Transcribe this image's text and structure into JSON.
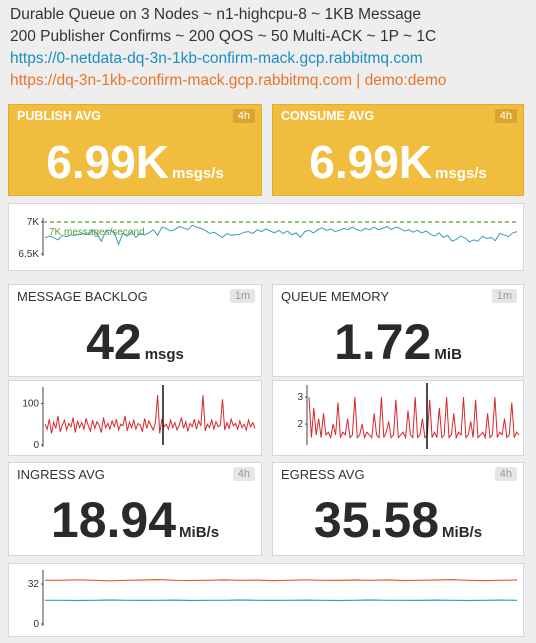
{
  "header": {
    "line1": "Durable Queue on 3 Nodes ~ n1-highcpu-8 ~ 1KB Message",
    "line2": "200 Publisher Confirms ~ 200 QOS ~ 50 Multi-ACK ~ 1P ~ 1C",
    "link_netdata": "https://0-netdata-dq-3n-1kb-confirm-mack.gcp.rabbitmq.com",
    "link_management": "https://dq-3n-1kb-confirm-mack.gcp.rabbitmq.com | demo:demo"
  },
  "panels": {
    "publish": {
      "title": "PUBLISH AVG",
      "range": "4h",
      "value": "6.99K",
      "unit": "msgs/s"
    },
    "consume": {
      "title": "CONSUME AVG",
      "range": "4h",
      "value": "6.99K",
      "unit": "msgs/s"
    },
    "backlog": {
      "title": "MESSAGE BACKLOG",
      "range": "1m",
      "value": "42",
      "unit": "msgs"
    },
    "memory": {
      "title": "QUEUE MEMORY",
      "range": "1m",
      "value": "1.72",
      "unit": "MiB"
    },
    "ingress": {
      "title": "INGRESS AVG",
      "range": "4h",
      "value": "18.94",
      "unit": "MiB/s"
    },
    "egress": {
      "title": "EGRESS AVG",
      "range": "4h",
      "value": "35.58",
      "unit": "MiB/s"
    }
  },
  "colors": {
    "gold": "#f1bd3e",
    "throughput_line": "#3a9dbb",
    "threshold_line": "#5aa02c",
    "red_line": "#d9262b",
    "ingress_line": "#e0632e",
    "egress_line": "#2c9ed6"
  },
  "chart_data": [
    {
      "type": "line",
      "id": "throughput",
      "yticks": [
        "7K",
        "6.5K"
      ],
      "annotation": "7K messages/second",
      "threshold": 7000,
      "ylim": [
        6500,
        7000
      ],
      "series": [
        {
          "values": [
            6750,
            6780,
            6760,
            6720,
            6790,
            6770,
            6800,
            6790,
            6810,
            6820,
            6800,
            6880,
            6820,
            6700,
            6850,
            6870,
            6830,
            6650,
            6820,
            6780,
            6850,
            6760,
            6820,
            6800,
            6830,
            6880,
            6790,
            6920,
            6900,
            6860,
            6880,
            6930,
            6910,
            6880,
            6950,
            6920,
            6900,
            6870,
            6820,
            6840,
            6800,
            6760,
            6820,
            6790,
            6800,
            6810,
            6840,
            6850,
            6820,
            6880,
            6850,
            6890,
            6860,
            6830,
            6870,
            6820,
            6860,
            6800,
            6830,
            6760,
            6850,
            6870,
            6830,
            6880,
            6910,
            6870,
            6890,
            6850,
            6870,
            6900,
            6880,
            6920,
            6880,
            6860,
            6900,
            6880,
            6920,
            6880,
            6900,
            6930,
            6880,
            6920,
            6900,
            6860,
            6880,
            6840,
            6870,
            6830,
            6860,
            6810,
            6780,
            6830,
            6760,
            6790,
            6700,
            6730,
            6780,
            6750,
            6690,
            6720,
            6700,
            6780,
            6740,
            6760,
            6710,
            6820,
            6800,
            6770,
            6830,
            6850
          ]
        }
      ]
    },
    {
      "type": "line",
      "id": "backlog",
      "yticks": [
        "100",
        "0"
      ],
      "ylim": [
        0,
        130
      ],
      "series": [
        {
          "values": [
            50,
            38,
            62,
            28,
            55,
            40,
            70,
            32,
            48,
            60,
            36,
            52,
            44,
            66,
            30,
            58,
            42,
            54,
            38,
            64,
            46,
            34,
            60,
            40,
            56,
            48,
            30,
            66,
            42,
            52,
            38,
            58,
            44,
            62,
            36,
            50,
            46,
            70,
            34,
            55,
            42,
            60,
            38,
            52,
            48,
            32,
            64,
            40,
            58,
            46,
            36,
            54,
            120,
            28,
            62,
            44,
            50,
            38,
            60,
            42,
            54,
            36,
            48,
            66,
            40,
            56,
            34,
            52,
            44,
            62,
            38,
            58,
            46,
            120,
            34,
            50,
            42,
            60,
            38,
            56,
            44,
            48,
            110,
            36,
            54,
            40,
            62,
            46,
            52,
            38,
            58,
            42,
            50,
            36,
            60,
            44,
            54,
            40
          ]
        }
      ]
    },
    {
      "type": "line",
      "id": "queue_memory",
      "yticks": [
        "3",
        "2"
      ],
      "ylim": [
        1.3,
        3.3
      ],
      "series": [
        {
          "values": [
            3.0,
            1.5,
            2.6,
            1.6,
            2.2,
            1.5,
            2.4,
            1.6,
            1.7,
            1.5,
            2.0,
            1.6,
            2.8,
            1.5,
            1.7,
            1.6,
            2.2,
            1.5,
            1.6,
            3.0,
            1.5,
            1.6,
            2.0,
            1.5,
            1.7,
            1.6,
            1.5,
            2.4,
            1.6,
            1.5,
            3.0,
            1.5,
            1.7,
            2.1,
            1.5,
            1.6,
            2.9,
            1.5,
            1.6,
            1.7,
            1.5,
            2.5,
            1.6,
            1.5,
            3.0,
            1.5,
            1.6,
            2.2,
            1.5,
            1.6,
            2.9,
            1.5,
            1.7,
            1.5,
            2.6,
            1.5,
            1.6,
            3.0,
            1.5,
            1.6,
            2.4,
            1.5,
            1.7,
            1.6,
            3.0,
            1.5,
            1.6,
            2.1,
            1.5,
            2.9,
            1.5,
            1.6,
            1.7,
            1.5,
            2.4,
            1.5,
            1.6,
            3.0,
            1.5,
            1.7,
            1.6,
            2.2,
            1.5,
            1.6,
            2.8,
            1.5,
            1.7,
            1.6
          ]
        }
      ]
    },
    {
      "type": "line",
      "id": "network",
      "yticks": [
        "32",
        "0"
      ],
      "ylim": [
        0,
        40
      ],
      "series": [
        {
          "values": [
            35,
            35,
            35.4,
            35,
            34.6,
            35,
            35.2,
            35.5,
            35,
            34.8,
            35,
            35.3,
            35,
            35.1,
            34.7,
            35,
            35.4,
            35,
            34.9,
            35.2,
            35,
            35.3,
            34.8,
            35,
            35.2,
            35.5,
            35,
            34.7,
            35,
            35.2
          ]
        },
        {
          "values": [
            19,
            19,
            18.8,
            19,
            19.2,
            19,
            18.9,
            19,
            19.1,
            18.8,
            19,
            19,
            19.2,
            19,
            18.9,
            19,
            19.1,
            19,
            18.8,
            19,
            19.2,
            19,
            19,
            18.9,
            19.1,
            19,
            18.8,
            19,
            19.1,
            19
          ]
        }
      ]
    }
  ]
}
